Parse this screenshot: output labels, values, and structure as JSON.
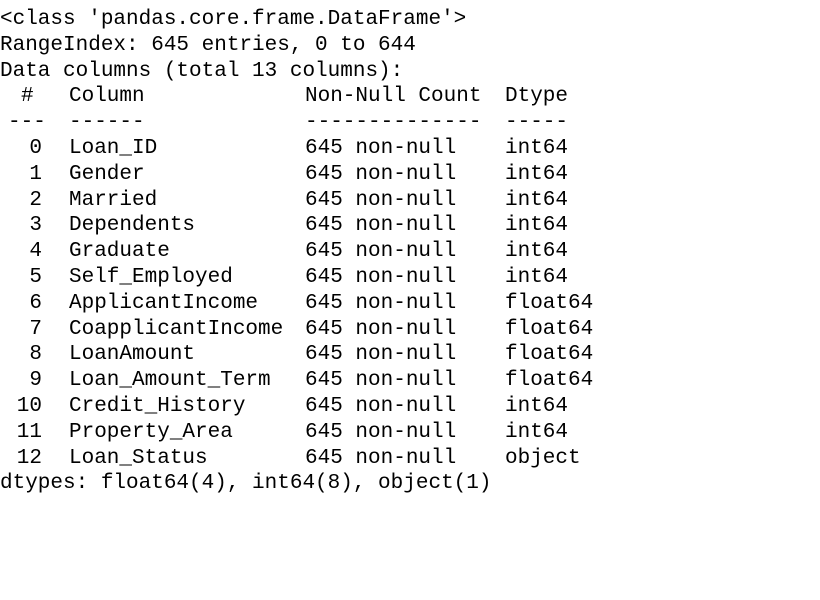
{
  "header": {
    "class_line": "<class 'pandas.core.frame.DataFrame'>",
    "range_line": "RangeIndex: 645 entries, 0 to 644",
    "columns_line": "Data columns (total 13 columns):"
  },
  "table": {
    "headers": {
      "idx": "#",
      "column": "Column",
      "count": "Non-Null Count",
      "dtype": "Dtype"
    },
    "separators": {
      "idx": "---",
      "column": "------",
      "count": "--------------",
      "dtype": "-----"
    },
    "rows": [
      {
        "idx": "0",
        "column": "Loan_ID",
        "count": "645 non-null",
        "dtype": "int64"
      },
      {
        "idx": "1",
        "column": "Gender",
        "count": "645 non-null",
        "dtype": "int64"
      },
      {
        "idx": "2",
        "column": "Married",
        "count": "645 non-null",
        "dtype": "int64"
      },
      {
        "idx": "3",
        "column": "Dependents",
        "count": "645 non-null",
        "dtype": "int64"
      },
      {
        "idx": "4",
        "column": "Graduate",
        "count": "645 non-null",
        "dtype": "int64"
      },
      {
        "idx": "5",
        "column": "Self_Employed",
        "count": "645 non-null",
        "dtype": "int64"
      },
      {
        "idx": "6",
        "column": "ApplicantIncome",
        "count": "645 non-null",
        "dtype": "float64"
      },
      {
        "idx": "7",
        "column": "CoapplicantIncome",
        "count": "645 non-null",
        "dtype": "float64"
      },
      {
        "idx": "8",
        "column": "LoanAmount",
        "count": "645 non-null",
        "dtype": "float64"
      },
      {
        "idx": "9",
        "column": "Loan_Amount_Term",
        "count": "645 non-null",
        "dtype": "float64"
      },
      {
        "idx": "10",
        "column": "Credit_History",
        "count": "645 non-null",
        "dtype": "int64"
      },
      {
        "idx": "11",
        "column": "Property_Area",
        "count": "645 non-null",
        "dtype": "int64"
      },
      {
        "idx": "12",
        "column": "Loan_Status",
        "count": "645 non-null",
        "dtype": "object"
      }
    ]
  },
  "footer": {
    "dtypes_line": "dtypes: float64(4), int64(8), object(1)"
  }
}
